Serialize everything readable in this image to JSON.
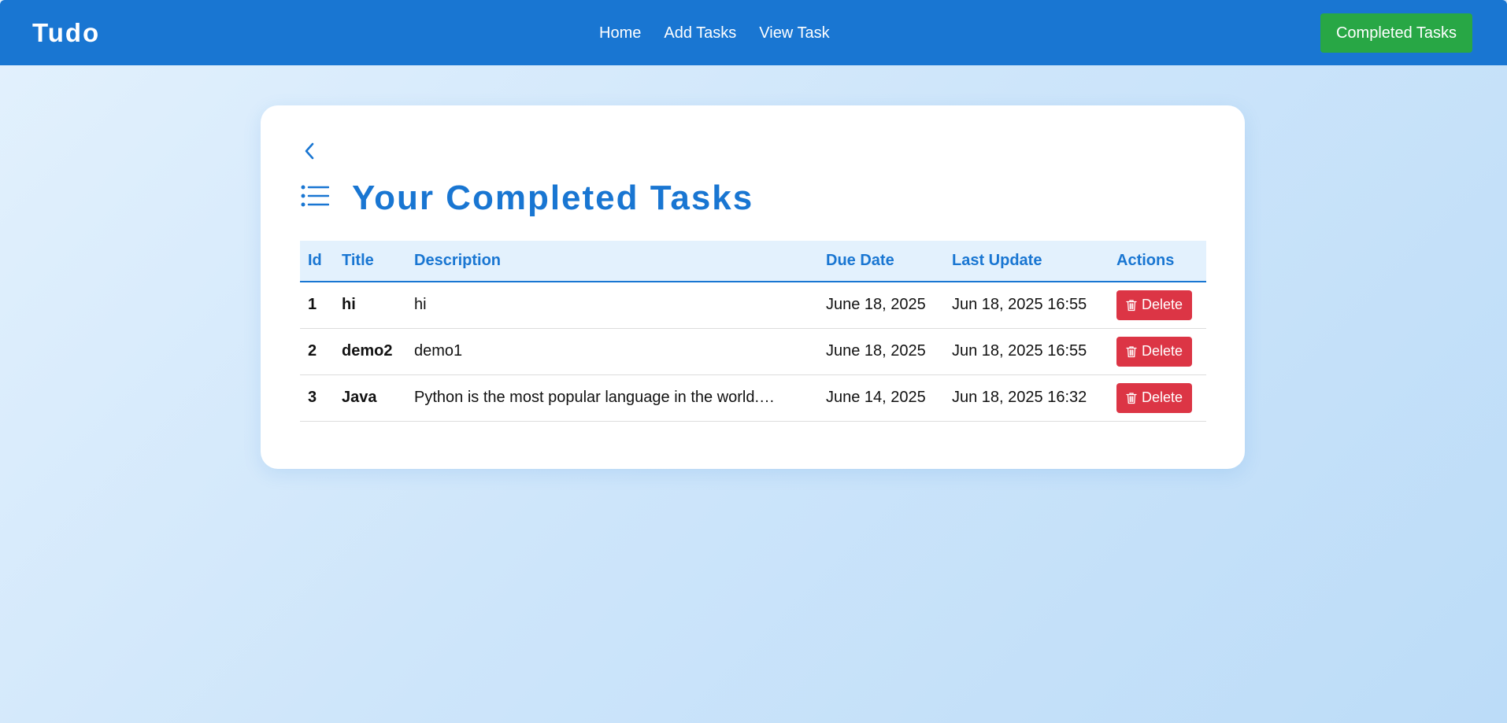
{
  "navbar": {
    "brand": "Tudo",
    "links": [
      "Home",
      "Add Tasks",
      "View Task"
    ],
    "cta_label": "Completed Tasks"
  },
  "page": {
    "title": "Your Completed Tasks"
  },
  "table": {
    "headers": [
      "Id",
      "Title",
      "Description",
      "Due Date",
      "Last Update",
      "Actions"
    ],
    "rows": [
      {
        "id": "1",
        "title": "hi",
        "description": "hi",
        "due_date": "June 18, 2025",
        "last_update": "Jun 18, 2025 16:55",
        "action_label": "Delete"
      },
      {
        "id": "2",
        "title": "demo2",
        "description": "demo1",
        "due_date": "June 18, 2025",
        "last_update": "Jun 18, 2025 16:55",
        "action_label": "Delete"
      },
      {
        "id": "3",
        "title": "Java",
        "description": "Python is the most popular language in the world.…",
        "due_date": "June 14, 2025",
        "last_update": "Jun 18, 2025 16:32",
        "action_label": "Delete"
      }
    ]
  },
  "icons": {
    "back": "chevron-left-icon",
    "list": "list-icon",
    "trash": "trash-icon"
  },
  "colors": {
    "primary": "#1976d2",
    "success": "#28a745",
    "danger": "#dc3545"
  }
}
